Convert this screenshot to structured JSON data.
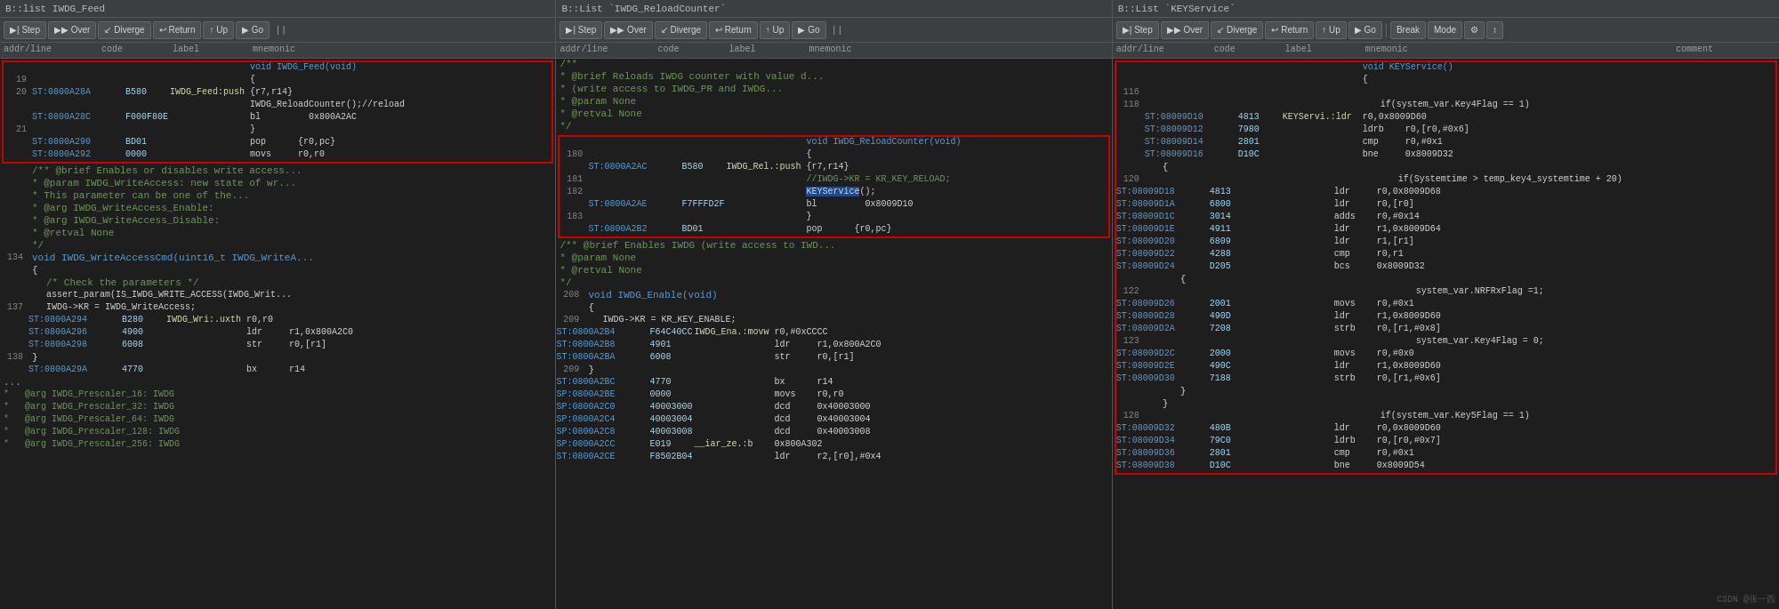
{
  "panels": [
    {
      "id": "panel1",
      "title": "B::list IWDG_Feed",
      "toolbar": {
        "buttons": [
          "Step",
          "Over",
          "Diverge",
          "Return",
          "Up",
          "Go"
        ]
      },
      "columns": [
        "addr/line",
        "code",
        "label",
        "mnemonic"
      ],
      "lines": []
    },
    {
      "id": "panel2",
      "title": "B::List `IWDG_ReloadCounter`",
      "toolbar": {
        "buttons": [
          "Step",
          "Over",
          "Diverge",
          "Return",
          "Up",
          "Go"
        ]
      },
      "columns": [
        "addr/line",
        "code",
        "label",
        "mnemonic"
      ],
      "lines": []
    },
    {
      "id": "panel3",
      "title": "B::List `KEYService`",
      "toolbar": {
        "buttons": [
          "Step",
          "Over",
          "Diverge",
          "Return",
          "Up",
          "Go",
          "Break",
          "Mode"
        ]
      },
      "columns": [
        "addr/line",
        "code",
        "label",
        "mnemonic",
        "comment"
      ],
      "lines": []
    }
  ],
  "toolbar": {
    "step_label": "Step",
    "over_label": "Over",
    "diverge_label": "Diverge",
    "return_label": "Return",
    "up_label": "Up",
    "go_label": "Go",
    "break_label": "Break",
    "mode_label": "Mode"
  },
  "watermark": "CSDN @张一西"
}
